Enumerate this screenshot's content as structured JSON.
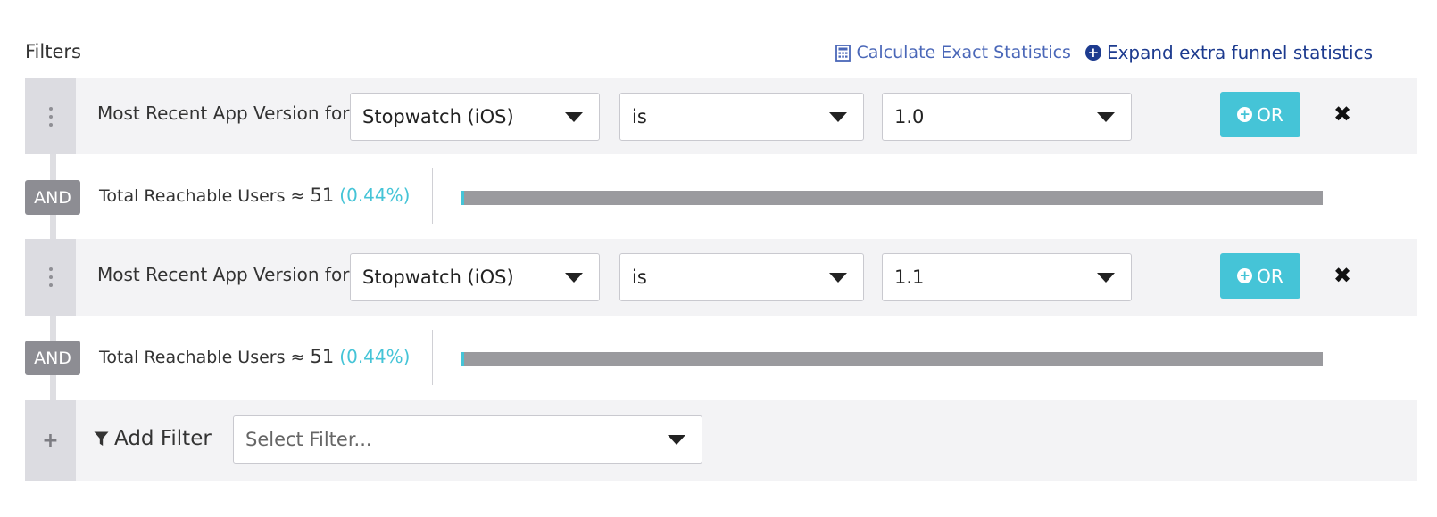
{
  "header": {
    "title": "Filters",
    "calc_link": "Calculate Exact Statistics",
    "expand_link": "Expand extra funnel statistics"
  },
  "filters": [
    {
      "label": "Most Recent App Version for",
      "app": "Stopwatch (iOS)",
      "operator": "is",
      "value": "1.0",
      "or_label": "OR"
    },
    {
      "label": "Most Recent App Version for",
      "app": "Stopwatch (iOS)",
      "operator": "is",
      "value": "1.1",
      "or_label": "OR"
    }
  ],
  "reach": [
    {
      "connector": "AND",
      "label": "Total Reachable Users ≈",
      "count": "51",
      "percent": "(0.44%)",
      "fraction": 0.0044
    },
    {
      "connector": "AND",
      "label": "Total Reachable Users ≈",
      "count": "51",
      "percent": "(0.44%)",
      "fraction": 0.0044
    }
  ],
  "add_filter": {
    "label": "Add Filter",
    "placeholder": "Select Filter..."
  },
  "colors": {
    "accent": "#45c4d7",
    "link": "#1d3b8f",
    "and_badge": "#8d8d93",
    "bar_track": "#9a9a9e"
  }
}
